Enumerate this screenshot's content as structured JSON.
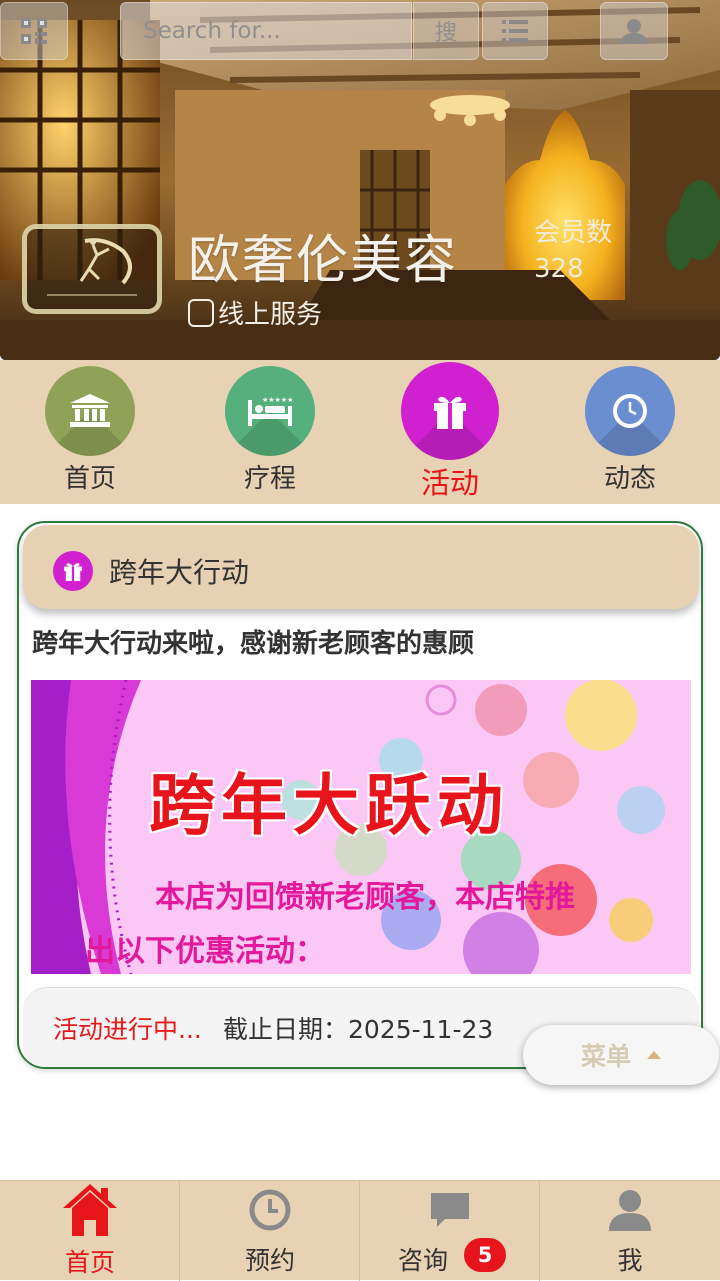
{
  "colors": {
    "accent_red": "#e8141c",
    "nav_bg": "#e7d3b3",
    "card_border": "#2f7a3b",
    "banner_pink": "#f9c5f3",
    "banner_magenta": "#e3189a"
  },
  "topbar": {
    "qr_icon": "qr-code-icon",
    "search_placeholder": "Search for...",
    "search_button_label": "搜",
    "list_icon": "list-icon",
    "user_icon": "user-icon"
  },
  "store": {
    "name": "欧奢伦美容",
    "logo_icon": "dancer-logo",
    "online_service": "线上服务",
    "member_label": "会员数",
    "member_count": "328"
  },
  "nav": {
    "items": [
      {
        "label": "首页",
        "icon": "bank-icon",
        "color": "#8fa258"
      },
      {
        "label": "疗程",
        "icon": "bed-icon",
        "color": "#55b07c"
      },
      {
        "label": "活动",
        "icon": "gift-icon",
        "color": "#d020d0",
        "active": true
      },
      {
        "label": "动态",
        "icon": "clock-icon",
        "color": "#6a8ed0"
      }
    ]
  },
  "activity": {
    "header_title": "跨年大行动",
    "subtitle": "跨年大行动来啦，感谢新老顾客的惠顾",
    "banner": {
      "title": "跨年大跃动",
      "line1": "本店为回馈新老顾客，本店特推",
      "line2": "出以下优惠活动："
    },
    "status": "活动进行中...",
    "deadline": "截止日期：2025-11-23"
  },
  "float_menu": {
    "label": "菜单"
  },
  "tabbar": {
    "tabs": [
      {
        "label": "首页",
        "icon": "home-icon",
        "active": true
      },
      {
        "label": "预约",
        "icon": "clock-icon"
      },
      {
        "label": "咨询",
        "icon": "chat-icon",
        "badge": "5"
      },
      {
        "label": "我",
        "icon": "person-icon"
      }
    ]
  }
}
